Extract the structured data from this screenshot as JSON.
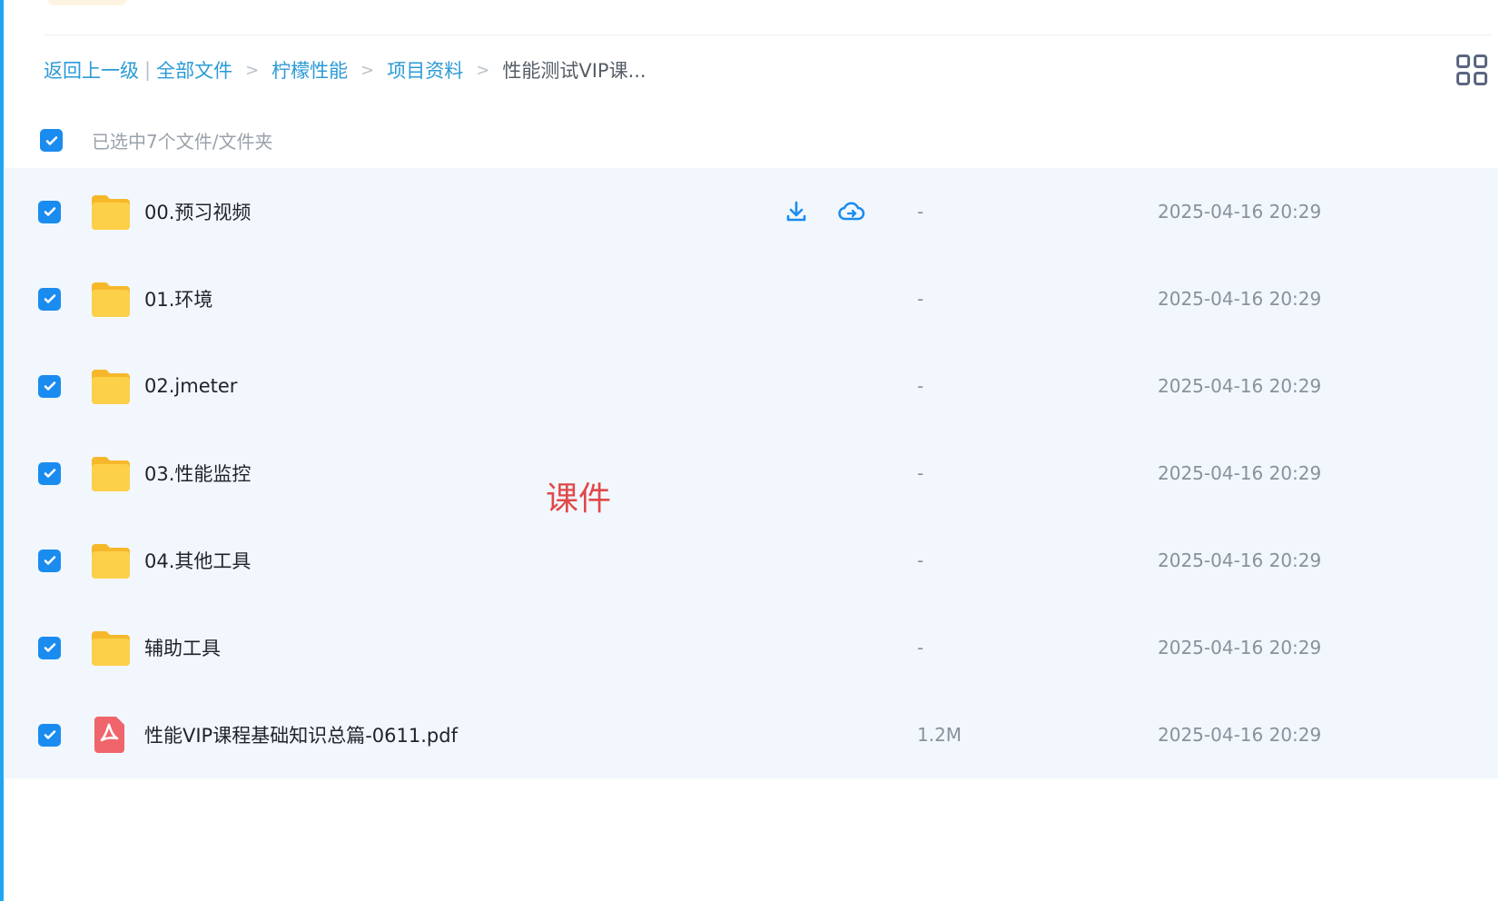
{
  "breadcrumb": {
    "back": "返回上一级",
    "items": [
      "全部文件",
      "柠檬性能",
      "项目资料"
    ],
    "current": "性能测试VIP课..."
  },
  "selection": {
    "label": "已选中7个文件/文件夹"
  },
  "files": [
    {
      "name": "00.预习视频",
      "type": "folder",
      "size": "-",
      "date": "2025-04-16 20:29"
    },
    {
      "name": "01.环境",
      "type": "folder",
      "size": "-",
      "date": "2025-04-16 20:29"
    },
    {
      "name": "02.jmeter",
      "type": "folder",
      "size": "-",
      "date": "2025-04-16 20:29"
    },
    {
      "name": "03.性能监控",
      "type": "folder",
      "size": "-",
      "date": "2025-04-16 20:29"
    },
    {
      "name": "04.其他工具",
      "type": "folder",
      "size": "-",
      "date": "2025-04-16 20:29"
    },
    {
      "name": "辅助工具",
      "type": "folder",
      "size": "-",
      "date": "2025-04-16 20:29"
    },
    {
      "name": "性能VIP课程基础知识总篇-0611.pdf",
      "type": "pdf",
      "size": "1.2M",
      "date": "2025-04-16 20:29"
    }
  ],
  "watermark": "课件",
  "colors": {
    "accent": "#1a8cf0",
    "link": "#2b9ad6",
    "folder": "#fcc83a",
    "pdf": "#f0646c",
    "watermark": "#e0484a"
  }
}
